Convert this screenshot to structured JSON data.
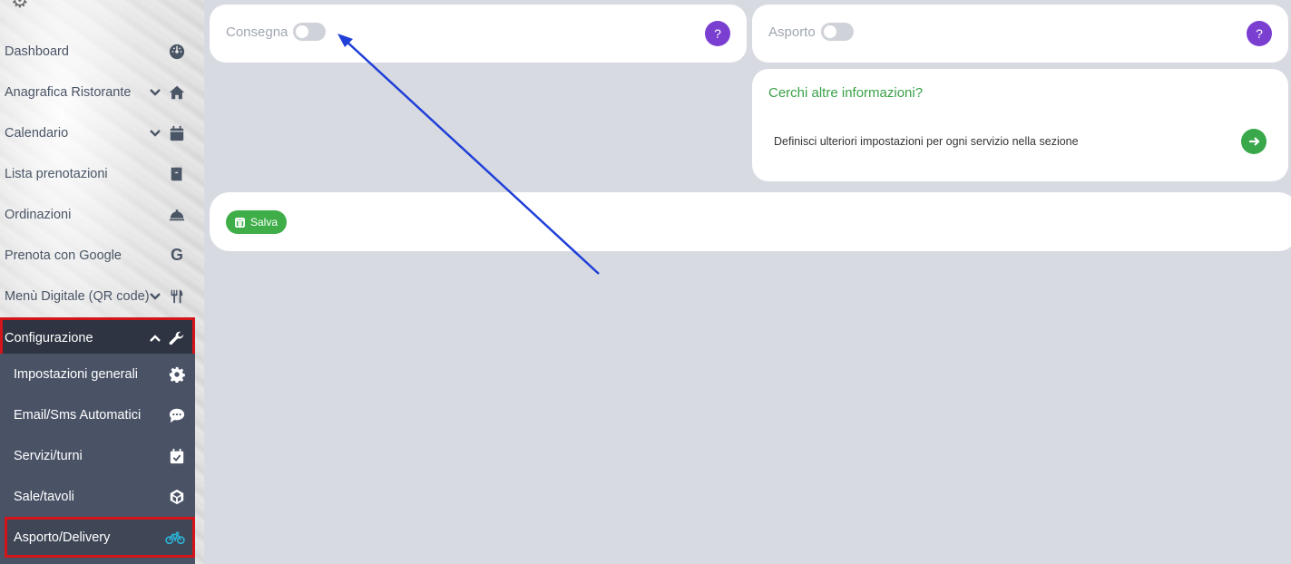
{
  "sidebar": {
    "items": [
      {
        "label": "Dashboard",
        "icon": "dashboard-icon",
        "has_chevron": false
      },
      {
        "label": "Anagrafica Ristorante",
        "icon": "home-icon",
        "has_chevron": true
      },
      {
        "label": "Calendario",
        "icon": "calendar-icon",
        "has_chevron": true
      },
      {
        "label": "Lista prenotazioni",
        "icon": "book-icon",
        "has_chevron": false
      },
      {
        "label": "Ordinazioni",
        "icon": "bell-icon",
        "has_chevron": false
      },
      {
        "label": "Prenota con Google",
        "icon": "google-icon",
        "has_chevron": false
      },
      {
        "label": "Menù Digitale (QR code)",
        "icon": "utensils-icon",
        "has_chevron": true
      },
      {
        "label": "Configurazione",
        "icon": "wrench-icon",
        "has_chevron": true,
        "expanded": true
      }
    ],
    "submenu": [
      {
        "label": "Impostazioni generali",
        "icon": "gear-icon"
      },
      {
        "label": "Email/Sms Automatici",
        "icon": "chat-icon"
      },
      {
        "label": "Servizi/turni",
        "icon": "calendar-check-icon"
      },
      {
        "label": "Sale/tavoli",
        "icon": "cube-icon"
      },
      {
        "label": "Asporto/Delivery",
        "icon": "bicycle-icon",
        "selected": true
      }
    ]
  },
  "consegna": {
    "label": "Consegna",
    "enabled": false,
    "help": "?"
  },
  "asporto": {
    "label": "Asporto",
    "enabled": false,
    "help": "?"
  },
  "info": {
    "title": "Cerchi altre informazioni?",
    "text": "Definisci ulteriori impostazioni per ogni servizio nella sezione"
  },
  "save": {
    "label": "Salva"
  },
  "colors": {
    "accent_purple": "#7a3fd1",
    "accent_green": "#3fae49",
    "annotation_arrow": "#1f3fd8",
    "highlight_red": "#d3141b"
  }
}
